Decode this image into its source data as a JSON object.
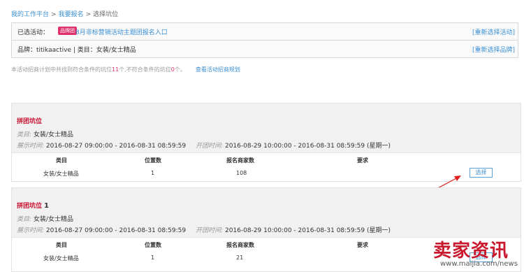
{
  "breadcrumb": {
    "items": [
      "我的工作平台",
      "我要报名",
      "选择坑位"
    ],
    "sep": ">"
  },
  "activity": {
    "label": "已选活动：",
    "badge": "品牌团",
    "link": "8月非标营销活动主题团报名入口",
    "reselect": "[重新选择活动]"
  },
  "brand": {
    "text": "品牌：titikaactive | 类目：女装/女士精品",
    "reselect": "[重新选择品牌]"
  },
  "summary": {
    "prefix": "本活动招商计划中共找到符合条件的坑位",
    "count": "11",
    "mid": "个,不符合条件的坑位",
    "count2": "0",
    "suffix": "个。",
    "link": "查看活动招商规划"
  },
  "cards": [
    {
      "title": "拼团坑位",
      "num": "",
      "category_key": "类目:",
      "category_val": "女装/女士精品",
      "show_key": "展示时间:",
      "show_val": "2016-08-27 09:00:00 - 2016-08-31 08:59:59",
      "open_key": "开团时间:",
      "open_val": "2016-08-29 10:00:00 - 2016-08-31 08:59:59 (星期一)",
      "headers": [
        "类目",
        "位置数",
        "报名商家数",
        "要求"
      ],
      "row": [
        "女装/女士精品",
        "1",
        "108",
        ""
      ],
      "button": "选择"
    },
    {
      "title": "拼团坑位",
      "num": "1",
      "category_key": "类目:",
      "category_val": "女装/女士精品",
      "show_key": "展示时间:",
      "show_val": "2016-08-27 09:00:00 - 2016-08-31 08:59:59",
      "open_key": "开团时间:",
      "open_val": "2016-08-29 10:00:00 - 2016-08-31 08:59:59 (星期一)",
      "headers": [
        "类目",
        "位置数",
        "报名商家数",
        "要求"
      ],
      "row": [
        "女装/女士精品",
        "1",
        "21",
        ""
      ],
      "button": "选择"
    }
  ],
  "watermark": {
    "big": "卖家资讯",
    "small": "www.maijia.com/news"
  },
  "colors": {
    "accent_red": "#c8102e",
    "link_blue": "#3a8fd4",
    "badge_pink": "#e0306a",
    "arrow_red": "#e02020"
  }
}
